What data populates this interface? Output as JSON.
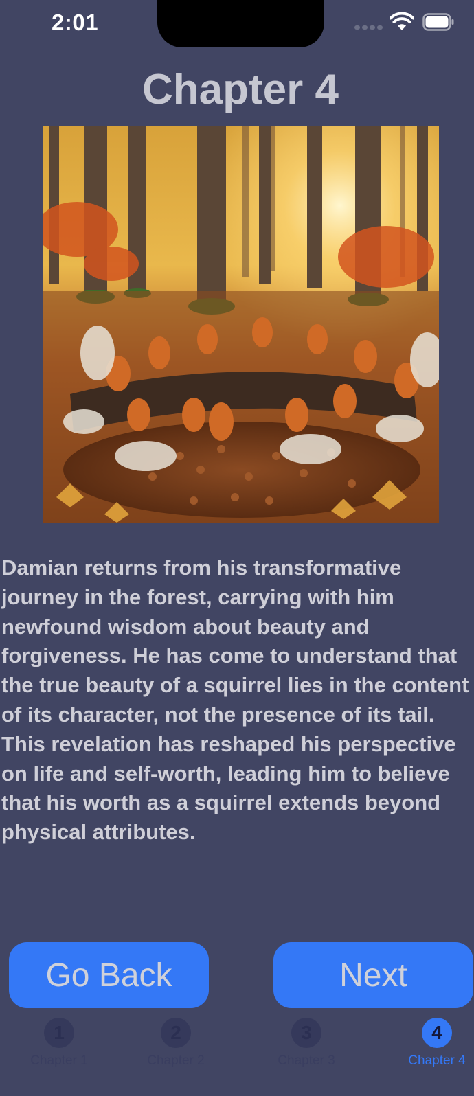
{
  "status_bar": {
    "time": "2:01",
    "signal_icon": "cellular-signal-icon",
    "wifi_icon": "wifi-icon",
    "battery_icon": "battery-icon"
  },
  "page": {
    "title": "Chapter 4",
    "illustration_subject": "squirrels gathered around a log with acorns in an autumn forest",
    "story": "Damian returns from his transformative journey in the forest, carrying with him newfound wisdom about beauty and forgiveness. He has come to understand that the true beauty of a squirrel lies in the content of its character, not the presence of its tail. This revelation has reshaped his perspective on life and self-worth, leading him to believe that his worth as a squirrel extends beyond physical attributes."
  },
  "buttons": {
    "back_label": "Go Back",
    "next_label": "Next"
  },
  "tabs": [
    {
      "number": "1",
      "label": "Chapter 1"
    },
    {
      "number": "2",
      "label": "Chapter 2"
    },
    {
      "number": "3",
      "label": "Chapter 3"
    },
    {
      "number": "4",
      "label": "Chapter 4"
    }
  ],
  "active_tab": "4",
  "colors": {
    "background": "#414563",
    "accent": "#3478f6",
    "title_text": "#c6c7d1"
  }
}
